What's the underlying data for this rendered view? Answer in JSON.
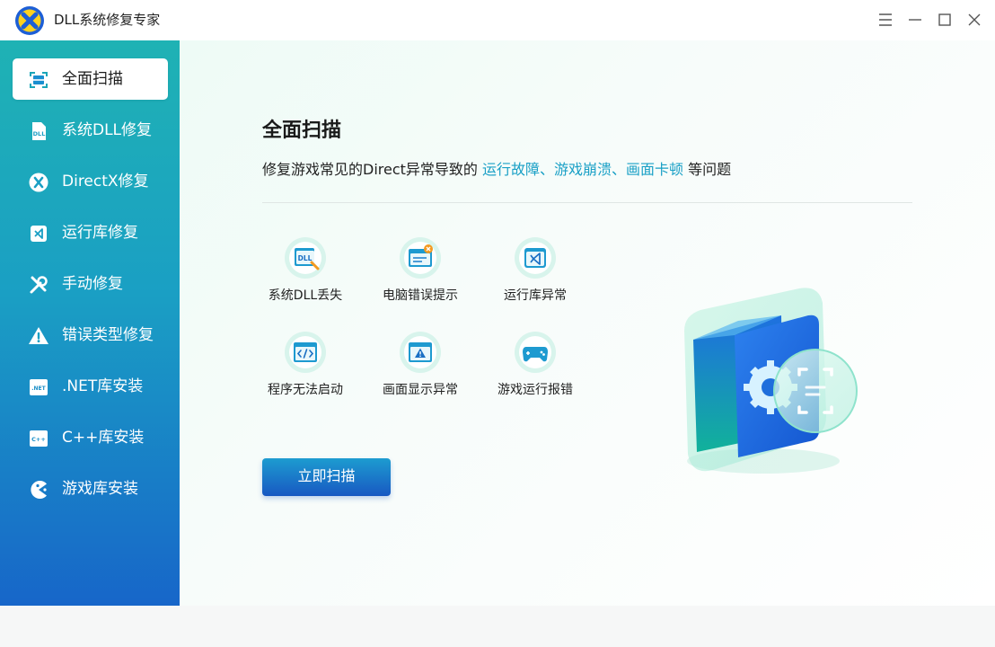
{
  "app": {
    "title": "DLL系统修复专家"
  },
  "window_controls": [
    {
      "name": "menu-button",
      "icon": "hamburger-icon"
    },
    {
      "name": "minimize-button",
      "icon": "minus-icon"
    },
    {
      "name": "maximize-button",
      "icon": "square-icon"
    },
    {
      "name": "close-button",
      "icon": "close-icon"
    }
  ],
  "sidebar": {
    "items": [
      {
        "label": "全面扫描",
        "icon": "scan-icon",
        "active": true
      },
      {
        "label": "系统DLL修复",
        "icon": "dll-file-icon",
        "active": false
      },
      {
        "label": "DirectX修复",
        "icon": "directx-icon",
        "active": false
      },
      {
        "label": "运行库修复",
        "icon": "visual-studio-icon",
        "active": false
      },
      {
        "label": "手动修复",
        "icon": "tools-icon",
        "active": false
      },
      {
        "label": "错误类型修复",
        "icon": "warning-icon",
        "active": false
      },
      {
        "label": ".NET库安装",
        "icon": "dotnet-icon",
        "active": false
      },
      {
        "label": "C++库安装",
        "icon": "cpp-icon",
        "active": false
      },
      {
        "label": "游戏库安装",
        "icon": "pacman-icon",
        "active": false
      }
    ]
  },
  "main": {
    "title": "全面扫描",
    "description_prefix": "修复游戏常见的Direct异常导致的 ",
    "description_highlight": "运行故障、游戏崩溃、画面卡顿",
    "description_suffix": " 等问题",
    "features": [
      {
        "label": "系统DLL丢失",
        "icon": "dll-missing-icon"
      },
      {
        "label": "电脑错误提示",
        "icon": "error-window-icon"
      },
      {
        "label": "运行库异常",
        "icon": "runtime-error-icon"
      },
      {
        "label": "程序无法启动",
        "icon": "code-window-icon"
      },
      {
        "label": "画面显示异常",
        "icon": "display-warning-icon"
      },
      {
        "label": "游戏运行报错",
        "icon": "gamepad-icon"
      }
    ],
    "scan_button": "立即扫描",
    "hero_icon": "scan-gear-illustration"
  },
  "colors": {
    "sidebar_top": "#1fb2b4",
    "sidebar_bottom": "#1766c9",
    "highlight_text": "#1aa0c6",
    "button_top": "#1d9cd0",
    "button_bottom": "#1858c2"
  }
}
